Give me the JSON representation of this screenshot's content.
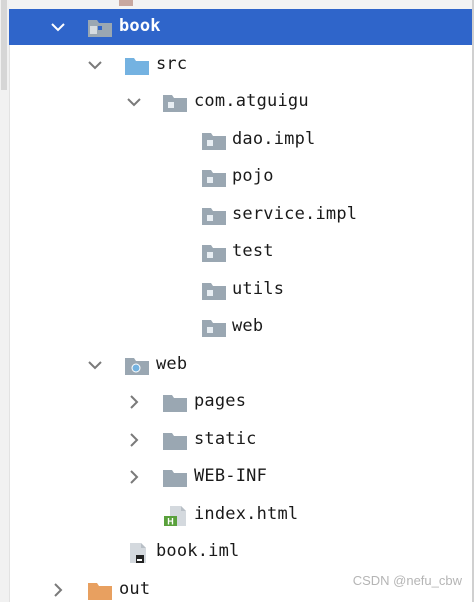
{
  "tree": {
    "rows": [
      {
        "label": "book",
        "depth": 0,
        "state": "expanded",
        "icon": "module-folder-icon",
        "selected": true
      },
      {
        "label": "src",
        "depth": 1,
        "state": "expanded",
        "icon": "source-folder-icon"
      },
      {
        "label": "com.atguigu",
        "depth": 2,
        "state": "expanded",
        "icon": "package-icon"
      },
      {
        "label": "dao.impl",
        "depth": 3,
        "state": "leaf",
        "icon": "package-icon"
      },
      {
        "label": "pojo",
        "depth": 3,
        "state": "leaf",
        "icon": "package-icon"
      },
      {
        "label": "service.impl",
        "depth": 3,
        "state": "leaf",
        "icon": "package-icon"
      },
      {
        "label": "test",
        "depth": 3,
        "state": "leaf",
        "icon": "package-icon"
      },
      {
        "label": "utils",
        "depth": 3,
        "state": "leaf",
        "icon": "package-icon"
      },
      {
        "label": "web",
        "depth": 3,
        "state": "leaf",
        "icon": "package-icon"
      },
      {
        "label": "web",
        "depth": 1,
        "state": "expanded",
        "icon": "web-folder-icon"
      },
      {
        "label": "pages",
        "depth": 2,
        "state": "collapsed",
        "icon": "folder-icon"
      },
      {
        "label": "static",
        "depth": 2,
        "state": "collapsed",
        "icon": "folder-icon"
      },
      {
        "label": "WEB-INF",
        "depth": 2,
        "state": "collapsed",
        "icon": "folder-icon"
      },
      {
        "label": "index.html",
        "depth": 2,
        "state": "leaf",
        "icon": "html-file-icon"
      },
      {
        "label": "book.iml",
        "depth": 1,
        "state": "leaf",
        "icon": "iml-file-icon"
      },
      {
        "label": "out",
        "depth": 0,
        "state": "collapsed",
        "icon": "excluded-folder-icon"
      }
    ]
  },
  "colors": {
    "selection": "#2f65ca",
    "folder": "#9aa7b2",
    "source_folder": "#74b2e0",
    "excluded_folder": "#e8a060",
    "html_badge": "#5aa13c"
  },
  "watermark": "CSDN @nefu_cbw"
}
